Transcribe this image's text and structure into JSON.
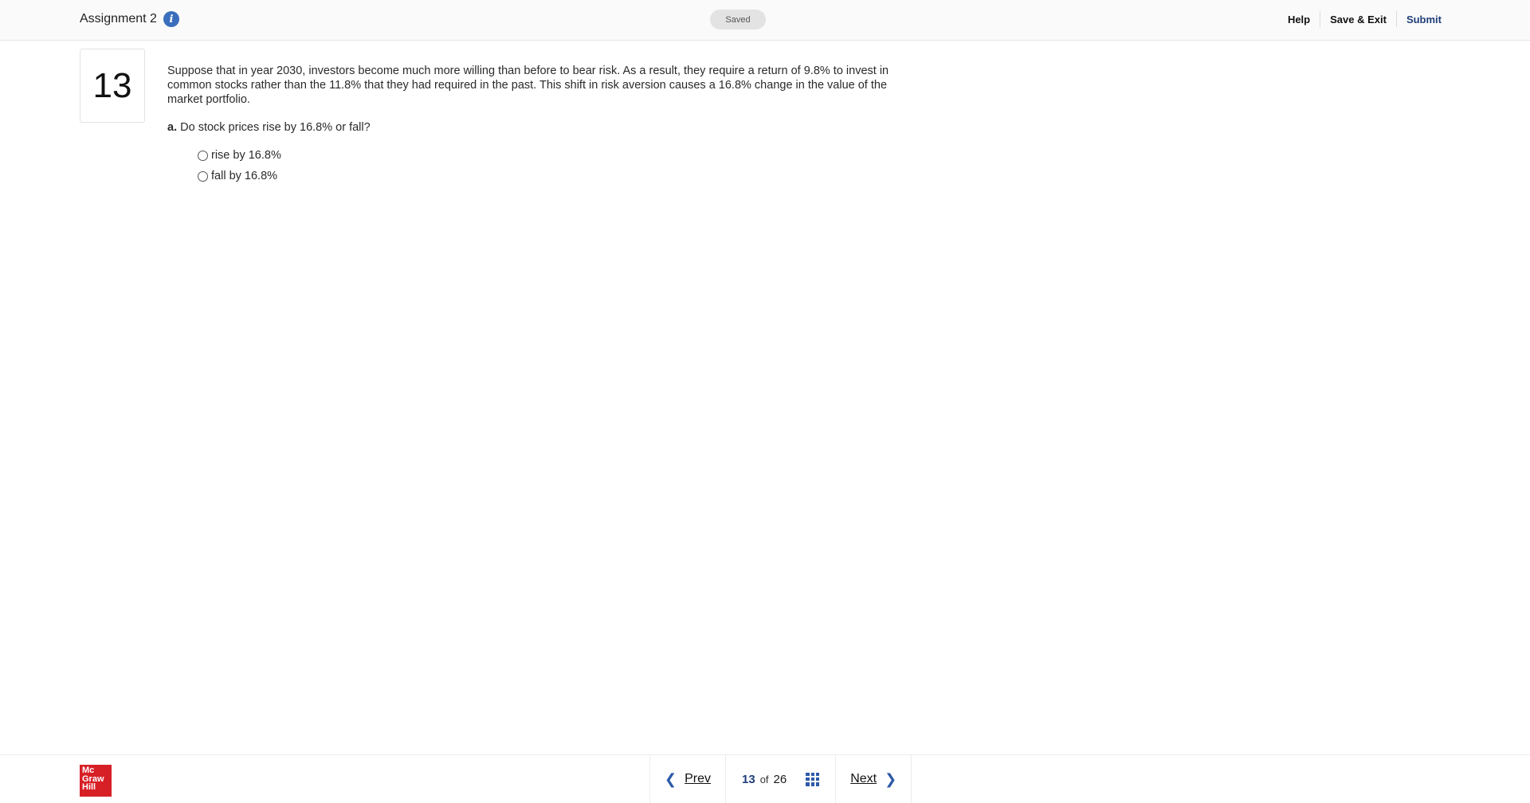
{
  "header": {
    "assignment_title": "Assignment 2",
    "info_icon": "info-icon",
    "saved_label": "Saved",
    "actions": {
      "help": "Help",
      "save_exit": "Save & Exit",
      "submit": "Submit"
    }
  },
  "question": {
    "number": "13",
    "prompt": "Suppose that in year 2030, investors become much more willing than before to bear risk. As a result, they require a return of 9.8% to invest in common stocks rather than the 11.8% that they had required in the past. This shift in risk aversion causes a 16.8% change in the value of the market portfolio.",
    "part_label": "a.",
    "part_text": "Do stock prices rise by 16.8% or fall?",
    "options": [
      {
        "label": "rise by 16.8%"
      },
      {
        "label": "fall by 16.8%"
      }
    ]
  },
  "footer": {
    "logo_lines": [
      "Mc",
      "Graw",
      "Hill"
    ],
    "prev_label": "Prev",
    "next_label": "Next",
    "current_page": "13",
    "of_label": "of",
    "total_pages": "26"
  },
  "colors": {
    "accent": "#2d5aa8",
    "brand": "#d71f26",
    "submit": "#1f3f7a"
  }
}
